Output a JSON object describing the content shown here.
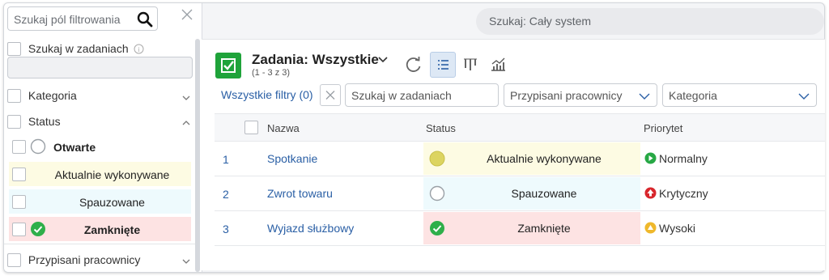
{
  "sidebar": {
    "search_placeholder": "Szukaj pól filtrowania",
    "search_in_tasks_label": "Szukaj w zadaniach",
    "groups": {
      "category": "Kategoria",
      "status": "Status",
      "assigned": "Przypisani pracownicy"
    },
    "status_items": [
      {
        "label": "Otwarte",
        "color": "#ffffff"
      },
      {
        "label": "Aktualnie wykonywane",
        "color": "#fdfbe3"
      },
      {
        "label": "Spauzowane",
        "color": "#eefafd"
      },
      {
        "label": "Zamknięte",
        "color": "#fde3e3"
      }
    ]
  },
  "topbar": {
    "search_placeholder": "Szukaj: Cały system"
  },
  "header": {
    "title": "Zadania: Wszystkie",
    "subtitle": "(1 - 3 z 3)"
  },
  "filters": {
    "all_filters_label": "Wszystkie filtry (0)",
    "search_tasks_placeholder": "Szukaj w zadaniach",
    "assigned_placeholder": "Przypisani pracownicy",
    "category_placeholder": "Kategoria"
  },
  "table": {
    "columns": [
      "Nazwa",
      "Status",
      "Priorytet"
    ],
    "rows": [
      {
        "num": "1",
        "name": "Spotkanie",
        "status": "Aktualnie wykonywane",
        "status_bg": "#fdfbe3",
        "priority": "Normalny",
        "priority_color": "#27a845"
      },
      {
        "num": "2",
        "name": "Zwrot towaru",
        "status": "Spauzowane",
        "status_bg": "#eefafd",
        "priority": "Krytyczny",
        "priority_color": "#d8262c"
      },
      {
        "num": "3",
        "name": "Wyjazd służbowy",
        "status": "Zamknięte",
        "status_bg": "#fde3e3",
        "priority": "Wysoki",
        "priority_color": "#efb82c"
      }
    ]
  },
  "colors": {
    "accent": "#1fa33a",
    "link": "#2a5fa5"
  }
}
